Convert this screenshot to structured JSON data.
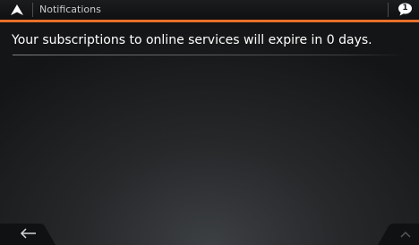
{
  "header": {
    "title": "Notifications",
    "badge_count": "1",
    "nav_icon": "navigation-arrow-icon",
    "badge_icon": "speech-bubble-icon"
  },
  "main": {
    "message": "Your subscriptions to online services will expire in 0 days."
  },
  "footer": {
    "back_icon": "back-arrow-icon",
    "up_icon": "chevron-up-icon"
  },
  "colors": {
    "accent": "#e8702a",
    "background": "#26282a",
    "text": "#ffffff"
  }
}
